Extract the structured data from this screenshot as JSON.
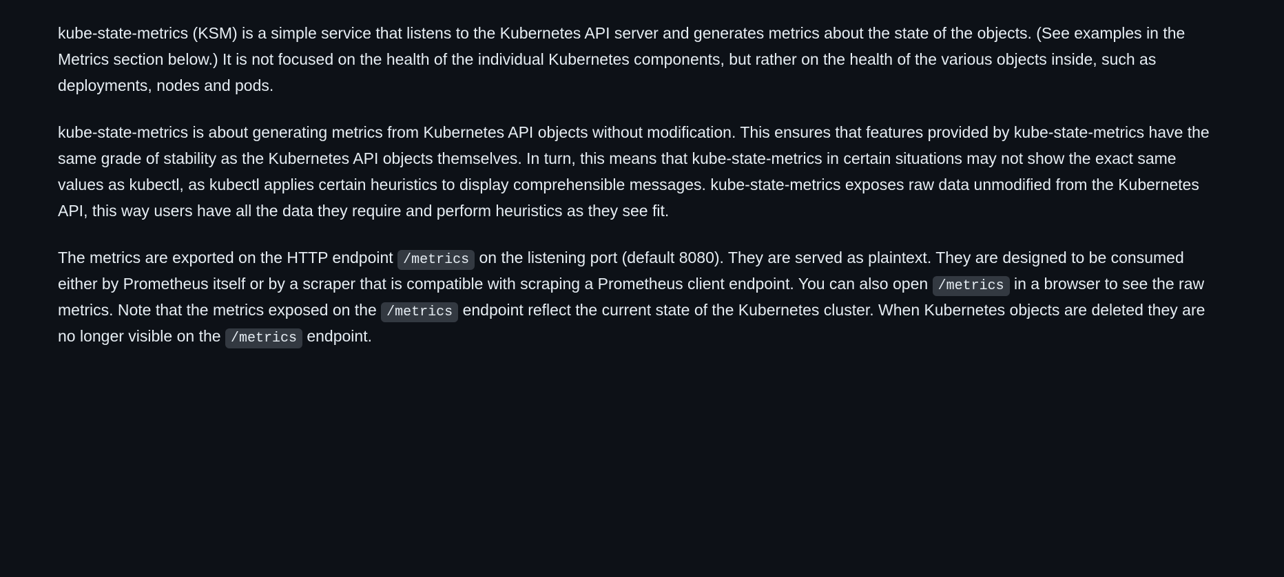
{
  "paragraphs": {
    "p1": "kube-state-metrics (KSM) is a simple service that listens to the Kubernetes API server and generates metrics about the state of the objects. (See examples in the Metrics section below.) It is not focused on the health of the individual Kubernetes components, but rather on the health of the various objects inside, such as deployments, nodes and pods.",
    "p2": "kube-state-metrics is about generating metrics from Kubernetes API objects without modification. This ensures that features provided by kube-state-metrics have the same grade of stability as the Kubernetes API objects themselves. In turn, this means that kube-state-metrics in certain situations may not show the exact same values as kubectl, as kubectl applies certain heuristics to display comprehensible messages. kube-state-metrics exposes raw data unmodified from the Kubernetes API, this way users have all the data they require and perform heuristics as they see fit.",
    "p3_part1": "The metrics are exported on the HTTP endpoint ",
    "p3_code1": "/metrics",
    "p3_part2": " on the listening port (default 8080). They are served as plaintext. They are designed to be consumed either by Prometheus itself or by a scraper that is compatible with scraping a Prometheus client endpoint. You can also open ",
    "p3_code2": "/metrics",
    "p3_part3": " in a browser to see the raw metrics. Note that the metrics exposed on the ",
    "p3_code3": "/metrics",
    "p3_part4": " endpoint reflect the current state of the Kubernetes cluster. When Kubernetes objects are deleted they are no longer visible on the ",
    "p3_code4": "/metrics",
    "p3_part5": " endpoint."
  }
}
